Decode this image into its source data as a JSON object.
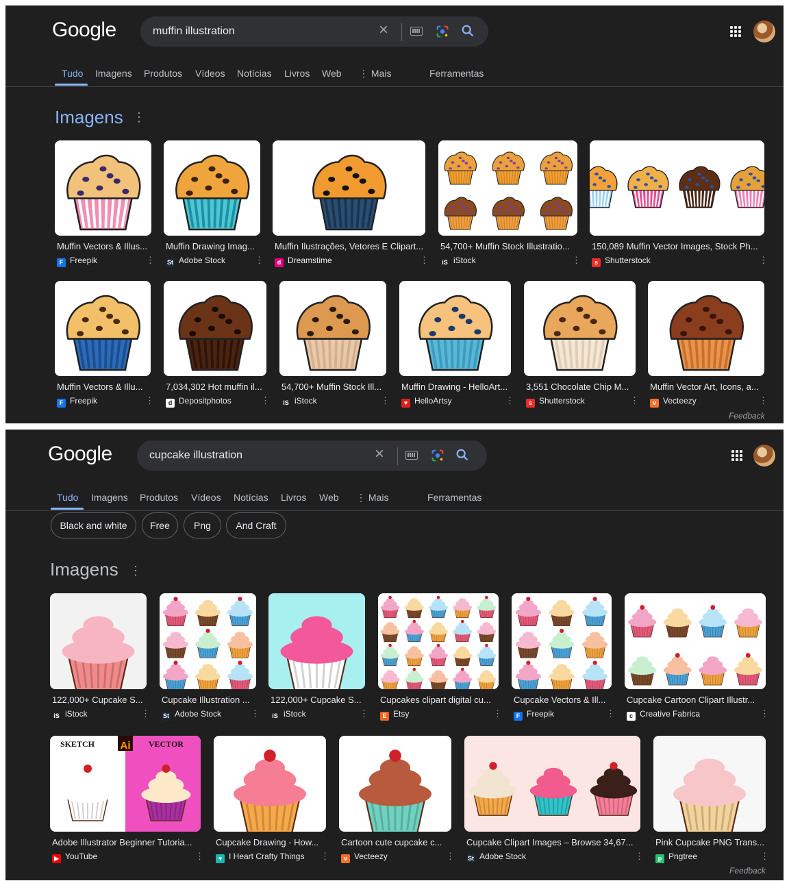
{
  "colors": {
    "background": "#1f1f1f",
    "accent": "#8ab4f8",
    "search_box": "#303134"
  },
  "panels": [
    {
      "logo": "Google",
      "query": "muffin illustration",
      "tabs": [
        "Tudo",
        "Imagens",
        "Produtos",
        "Vídeos",
        "Notícias",
        "Livros",
        "Web",
        "⋮ Mais",
        "Ferramentas"
      ],
      "active_tab": "Tudo",
      "section_title": "Imagens",
      "feedback": "Feedback",
      "results": [
        {
          "title": "Muffin Vectors & Illus...",
          "source": "Freepik",
          "icon": "freepik-icon"
        },
        {
          "title": "Muffin Drawing Imag...",
          "source": "Adobe Stock",
          "icon": "adobe-stock-icon"
        },
        {
          "title": "Muffin Ilustrações, Vetores E Clipart...",
          "source": "Dreamstime",
          "icon": "dreamstime-icon"
        },
        {
          "title": "54,700+ Muffin Stock Illustratio...",
          "source": "iStock",
          "icon": "istock-icon"
        },
        {
          "title": "150,089 Muffin Vector Images, Stock Ph...",
          "source": "Shutterstock",
          "icon": "shutterstock-icon"
        },
        {
          "title": "Muffin Vectors & Illu...",
          "source": "Freepik",
          "icon": "freepik-icon"
        },
        {
          "title": "7,034,302 Hot muffin il...",
          "source": "Depositphotos",
          "icon": "depositphotos-icon"
        },
        {
          "title": "54,700+ Muffin Stock Ill...",
          "source": "iStock",
          "icon": "istock-icon"
        },
        {
          "title": "Muffin Drawing - HelloArt...",
          "source": "HelloArtsy",
          "icon": "helloartsy-icon"
        },
        {
          "title": "3,551 Chocolate Chip M...",
          "source": "Shutterstock",
          "icon": "shutterstock-icon"
        },
        {
          "title": "Muffin Vector Art, Icons, a...",
          "source": "Vecteezy",
          "icon": "vecteezy-icon"
        }
      ]
    },
    {
      "logo": "Google",
      "query": "cupcake illustration",
      "tabs": [
        "Tudo",
        "Imagens",
        "Produtos",
        "Vídeos",
        "Notícias",
        "Livros",
        "Web",
        "⋮ Mais",
        "Ferramentas"
      ],
      "active_tab": "Tudo",
      "chips": [
        "Black and white",
        "Free",
        "Png",
        "And Craft"
      ],
      "section_title": "Imagens",
      "feedback": "Feedback",
      "results": [
        {
          "title": "122,000+ Cupcake S...",
          "source": "iStock",
          "icon": "istock-icon"
        },
        {
          "title": "Cupcake Illustration ...",
          "source": "Adobe Stock",
          "icon": "adobe-stock-icon"
        },
        {
          "title": "122,000+ Cupcake S...",
          "source": "iStock",
          "icon": "istock-icon"
        },
        {
          "title": "Cupcakes clipart digital cu...",
          "source": "Etsy",
          "icon": "etsy-icon"
        },
        {
          "title": "Cupcake Vectors & Ill...",
          "source": "Freepik",
          "icon": "freepik-icon"
        },
        {
          "title": "Cupcake Cartoon Clipart Illustr...",
          "source": "Creative Fabrica",
          "icon": "creative-fabrica-icon"
        },
        {
          "title": "Adobe Illustrator Beginner Tutoria...",
          "source": "YouTube",
          "icon": "youtube-icon",
          "thumb_labels": [
            "SKETCH",
            "Ai",
            "VECTOR"
          ]
        },
        {
          "title": "Cupcake Drawing - How...",
          "source": "I Heart Crafty Things",
          "icon": "iheartcrafty-icon"
        },
        {
          "title": "Cartoon cute cupcake c...",
          "source": "Vecteezy",
          "icon": "vecteezy-icon"
        },
        {
          "title": "Cupcake Clipart Images – Browse 34,67...",
          "source": "Adobe Stock",
          "icon": "adobe-stock-icon"
        },
        {
          "title": "Pink Cupcake PNG Trans...",
          "source": "Pngtree",
          "icon": "pngtree-icon"
        }
      ]
    }
  ]
}
